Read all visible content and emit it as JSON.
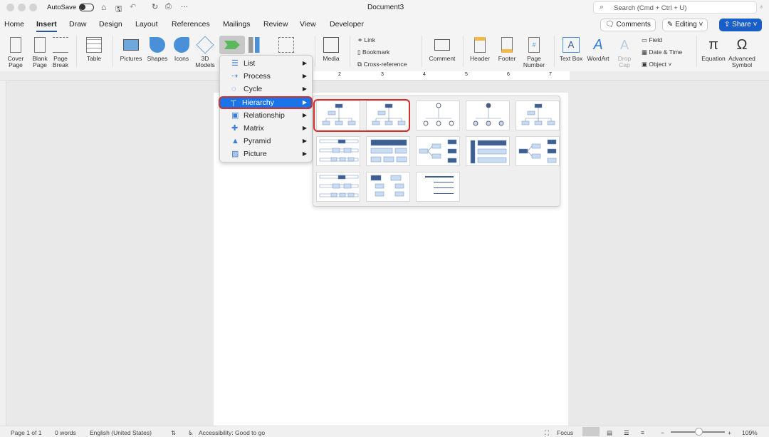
{
  "titlebar": {
    "autosave": "AutoSave",
    "doc_title": "Document3",
    "search_placeholder": "Search (Cmd + Ctrl + U)",
    "more": "···"
  },
  "tabs": [
    "Home",
    "Insert",
    "Draw",
    "Design",
    "Layout",
    "References",
    "Mailings",
    "Review",
    "View",
    "Developer"
  ],
  "active_tab": "Insert",
  "actions": {
    "comments": "Comments",
    "editing": "Editing",
    "share": "Share"
  },
  "ribbon": {
    "cover_page": "Cover Page",
    "blank_page": "Blank Page",
    "page_break": "Page Break",
    "table": "Table",
    "pictures": "Pictures",
    "shapes": "Shapes",
    "icons": "Icons",
    "models_3d": "3D Models",
    "media": "Media",
    "link": "Link",
    "bookmark": "Bookmark",
    "cross_reference": "Cross-reference",
    "comment": "Comment",
    "header": "Header",
    "footer": "Footer",
    "page_number": "Page Number",
    "text_box": "Text Box",
    "wordart": "WordArt",
    "drop_cap": "Drop Cap",
    "field": "Field",
    "date_time": "Date & Time",
    "object": "Object",
    "equation": "Equation",
    "advanced_symbol": "Advanced Symbol"
  },
  "ruler": [
    "2",
    "3",
    "4",
    "5",
    "6",
    "7"
  ],
  "smartart_menu": {
    "items": [
      "List",
      "Process",
      "Cycle",
      "Hierarchy",
      "Relationship",
      "Matrix",
      "Pyramid",
      "Picture"
    ],
    "selected": "Hierarchy"
  },
  "gallery": {
    "count": 13,
    "highlighted": [
      0,
      1
    ]
  },
  "status": {
    "page": "Page 1 of 1",
    "words": "0 words",
    "language": "English (United States)",
    "accessibility": "Accessibility: Good to go",
    "focus": "Focus",
    "zoom": "109%",
    "zoom_minus": "−",
    "zoom_plus": "+"
  },
  "colors": {
    "accent": "#2b579a",
    "share": "#1a5fc7",
    "selection": "#1a73e8",
    "highlight_outline": "#d32f2f"
  }
}
